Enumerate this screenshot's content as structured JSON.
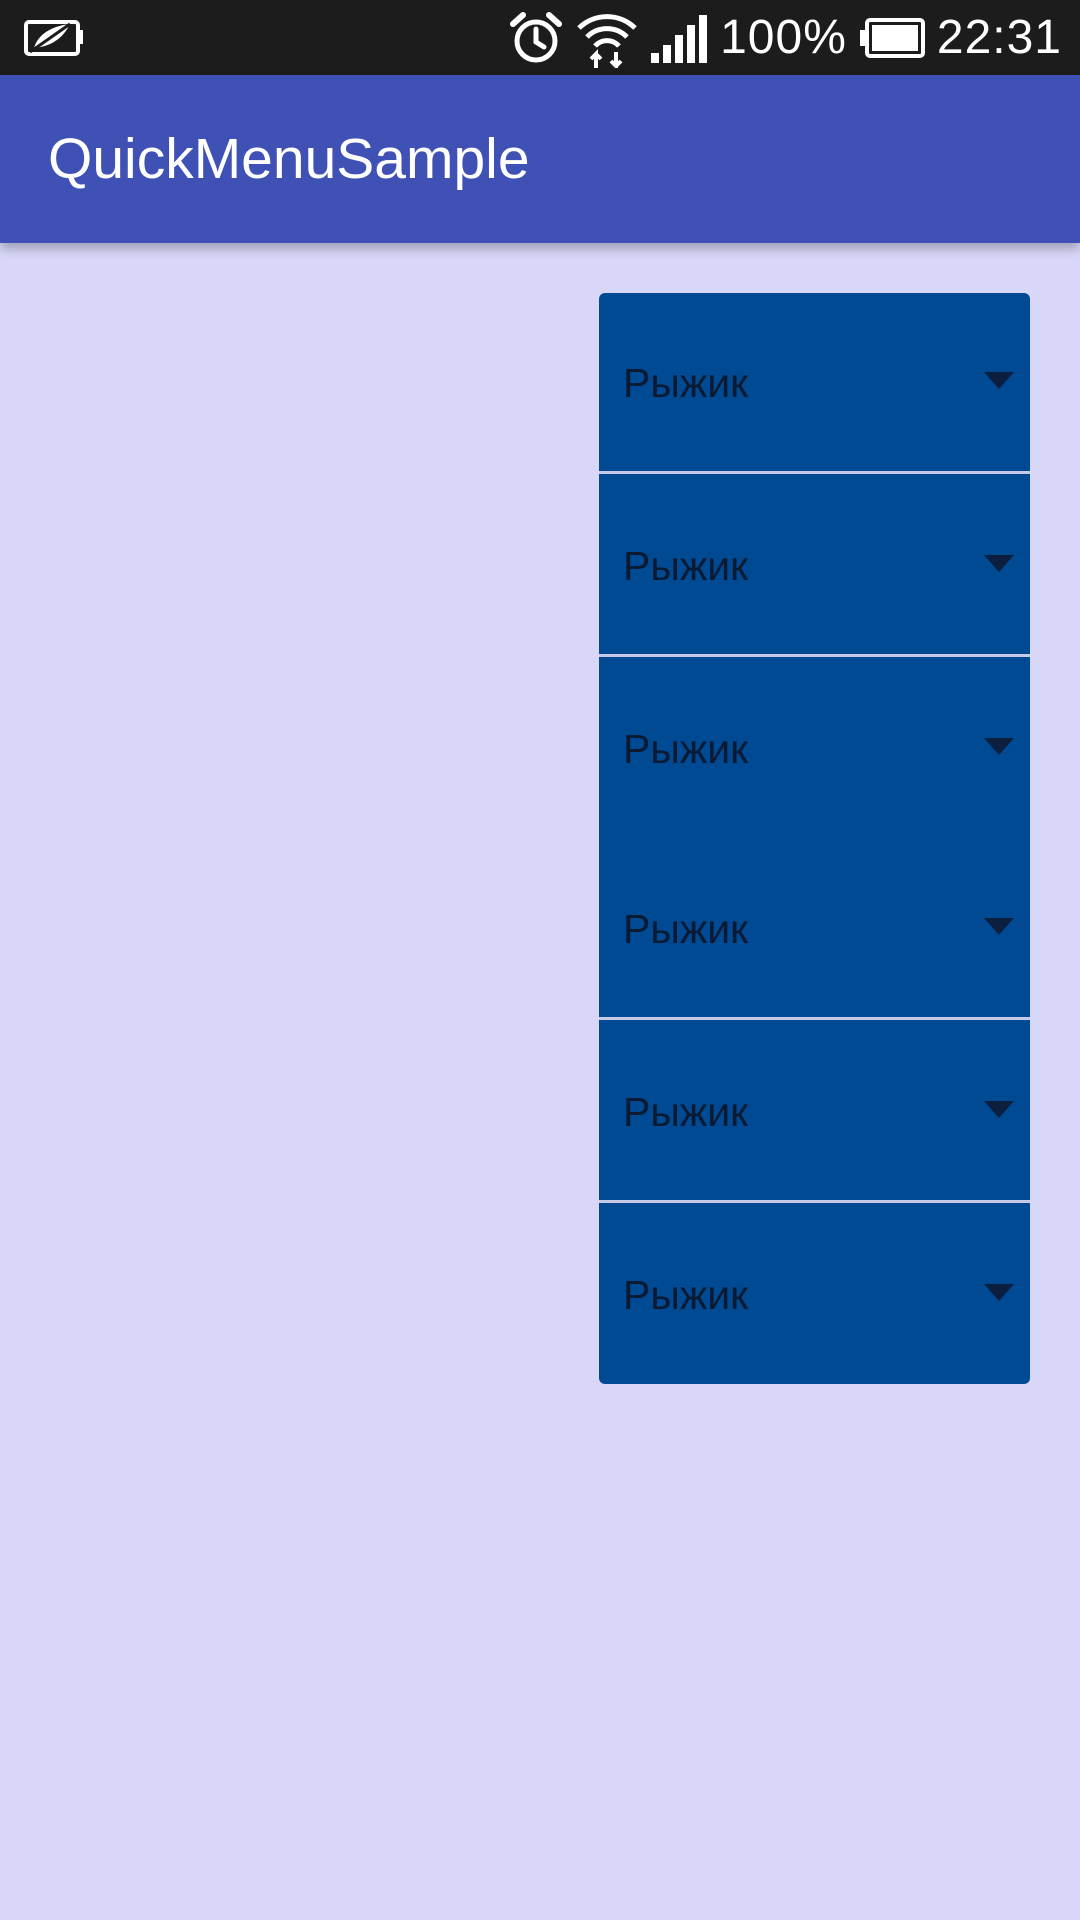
{
  "status_bar": {
    "battery_percent": "100%",
    "time": "22:31",
    "icons": [
      "battery-saver-icon",
      "alarm-clock-icon",
      "wifi-icon",
      "signal-icon",
      "battery-icon"
    ]
  },
  "app_bar": {
    "title": "QuickMenuSample"
  },
  "spinners": [
    {
      "label": "Рыжик"
    },
    {
      "label": "Рыжик"
    },
    {
      "label": "Рыжик"
    },
    {
      "label": "Рыжик"
    },
    {
      "label": "Рыжик"
    },
    {
      "label": "Рыжик"
    }
  ],
  "colors": {
    "background": "#d8d7f8",
    "app_bar": "#3f51b5",
    "status_bar": "#1c1c1c",
    "spinner": "#004a94",
    "divider": "#c7c9e6"
  }
}
